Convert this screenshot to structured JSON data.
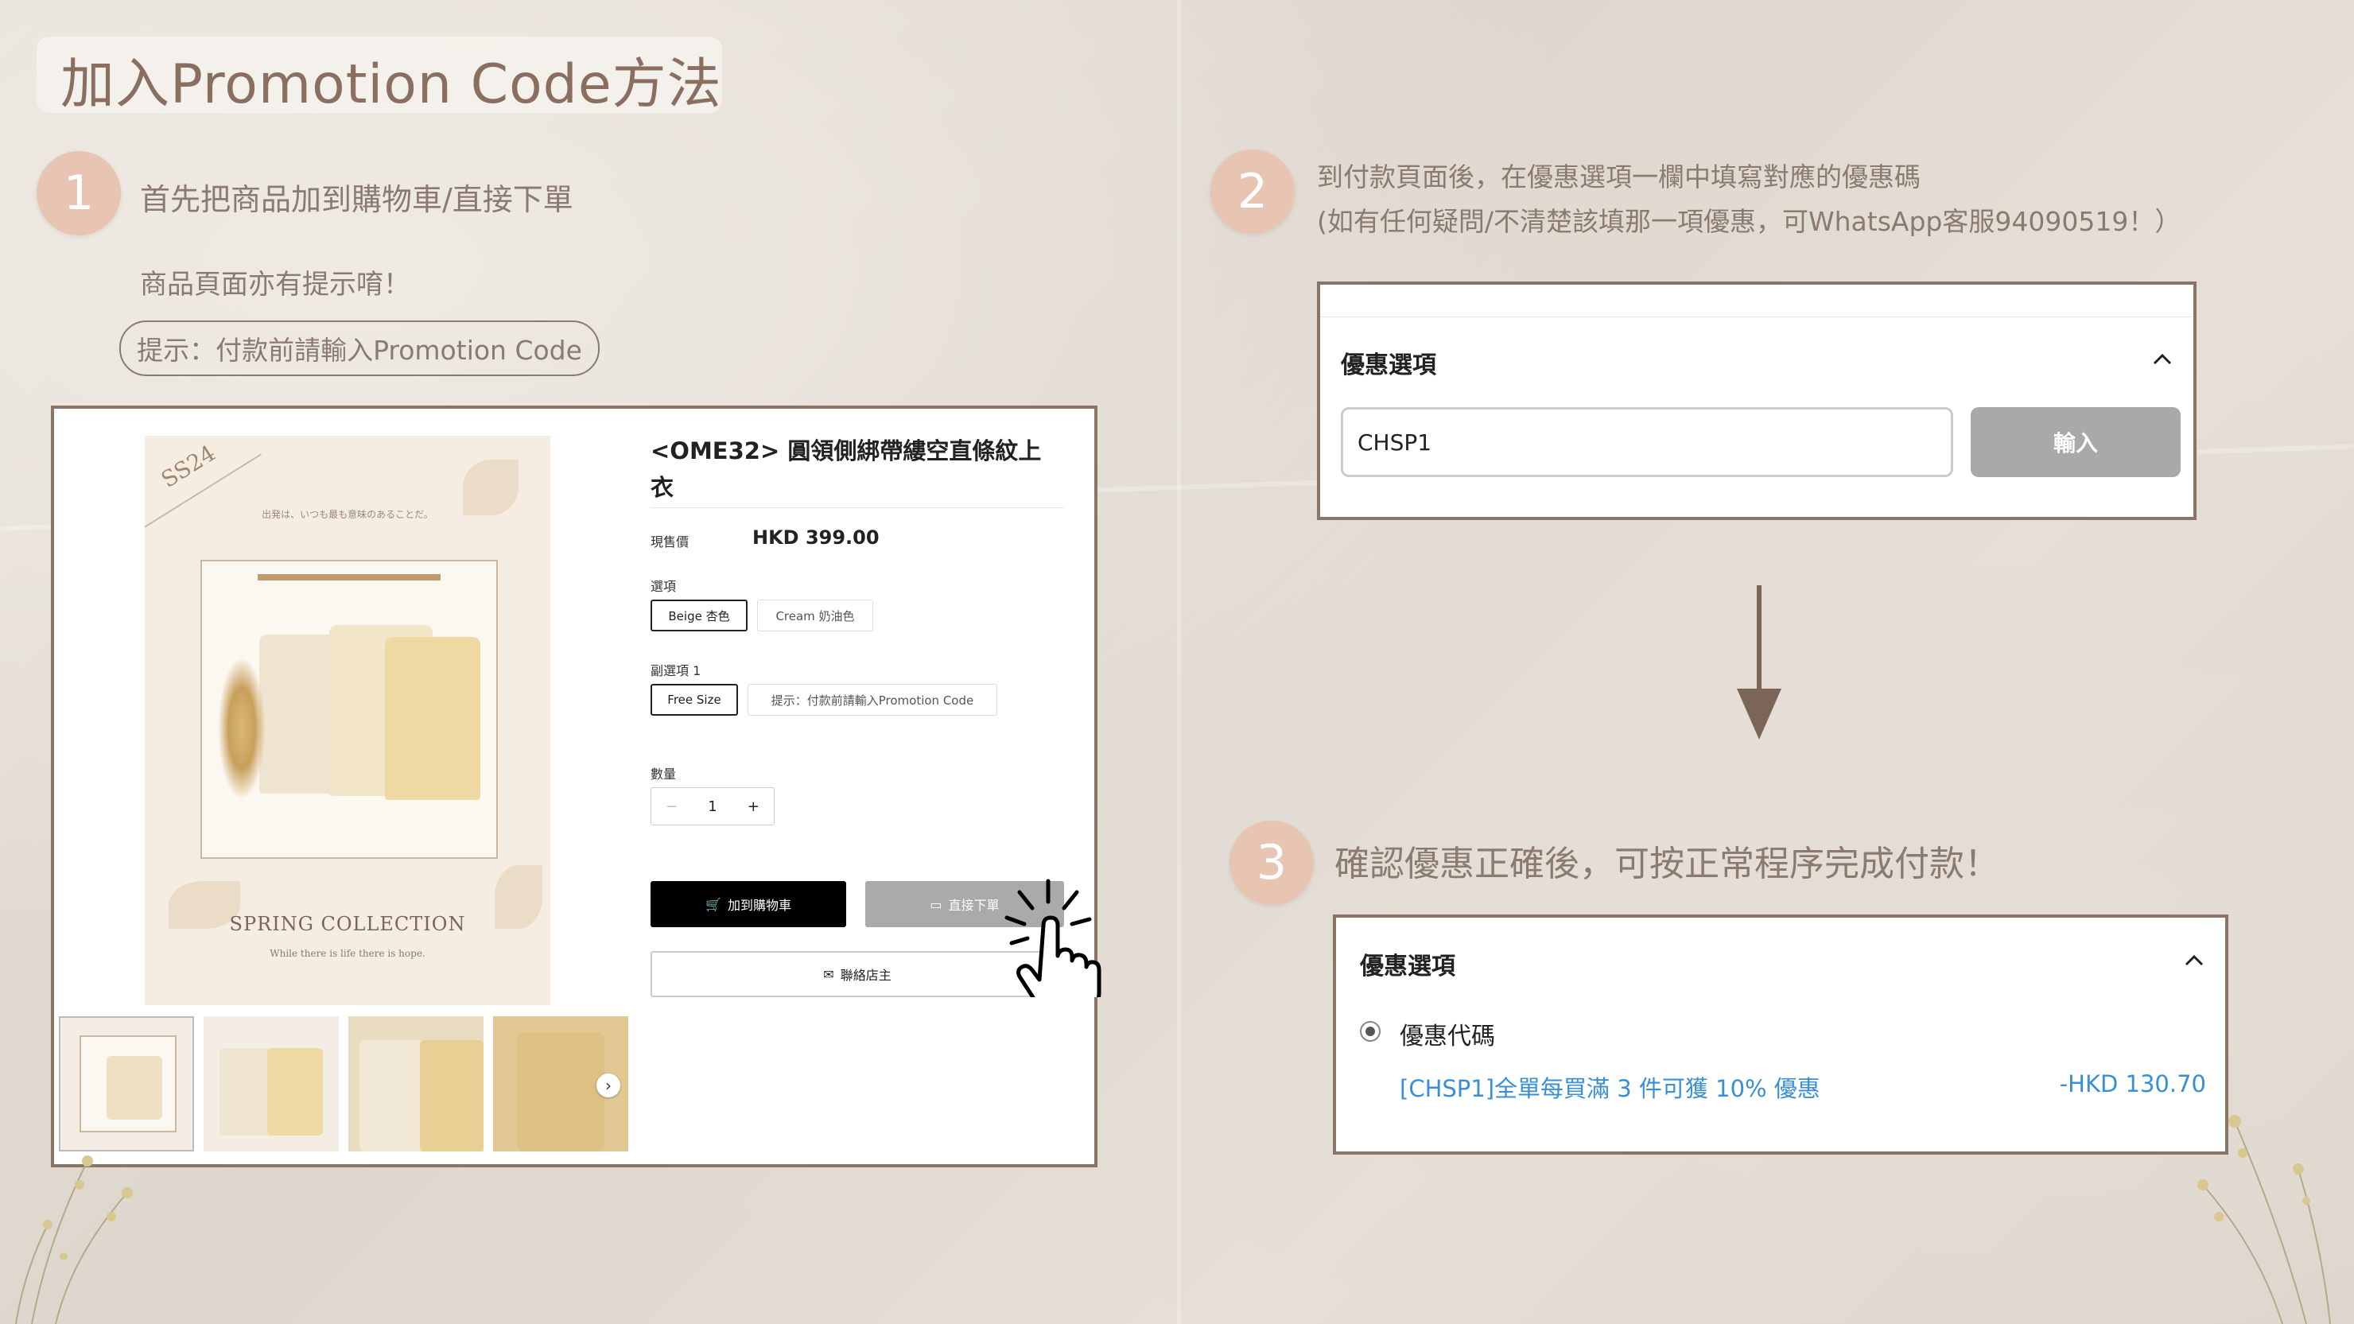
{
  "header": {
    "title": "加入Promotion Code方法"
  },
  "step1": {
    "number": "1",
    "text": "首先把商品加到購物車/直接下單",
    "subtext": "商品頁面亦有提示唷！",
    "hint": "提示：付款前請輸入Promotion Code"
  },
  "product_page": {
    "poster_badge": "SS24",
    "poster_tagline": "出発は、いつも最も意味のあることだ。",
    "poster_collection": "SPRING COLLECTION",
    "poster_collection_sub": "While there is life there is hope.",
    "title": "<OME32> 圓領側綁帶縷空直條紋上衣",
    "price_label": "現售價",
    "price": "HKD 399.00",
    "option_label": "選項",
    "options": [
      "Beige 杏色",
      "Cream 奶油色"
    ],
    "suboption_label": "副選項 1",
    "suboptions": [
      "Free Size",
      "提示：付款前請輸入Promotion Code"
    ],
    "qty_label": "數量",
    "qty_minus": "−",
    "qty_value": "1",
    "qty_plus": "+",
    "add_to_cart": "加到購物車",
    "buy_now": "直接下單",
    "contact": "聯絡店主"
  },
  "step2": {
    "number": "2",
    "line1": "到付款頁面後，在優惠選項一欄中填寫對應的優惠碼",
    "line2": "(如有任何疑問/不清楚該填那一項優惠，可WhatsApp客服94090519！）",
    "panel_title": "優惠選項",
    "code_value": "CHSP1",
    "apply_label": "輸入"
  },
  "step3": {
    "number": "3",
    "text": "確認優惠正確後，可按正常程序完成付款！",
    "panel_title": "優惠選項",
    "option_label": "優惠代碼",
    "promo_desc": "[CHSP1]全單每買滿 3 件可獲 10% 優惠",
    "promo_amount": "-HKD 130.70"
  },
  "colors": {
    "accent_brown": "#8a7466",
    "step_circle": "#e8c5b2",
    "promo_blue": "#3a8fd4",
    "background": "#e4ddd4"
  }
}
